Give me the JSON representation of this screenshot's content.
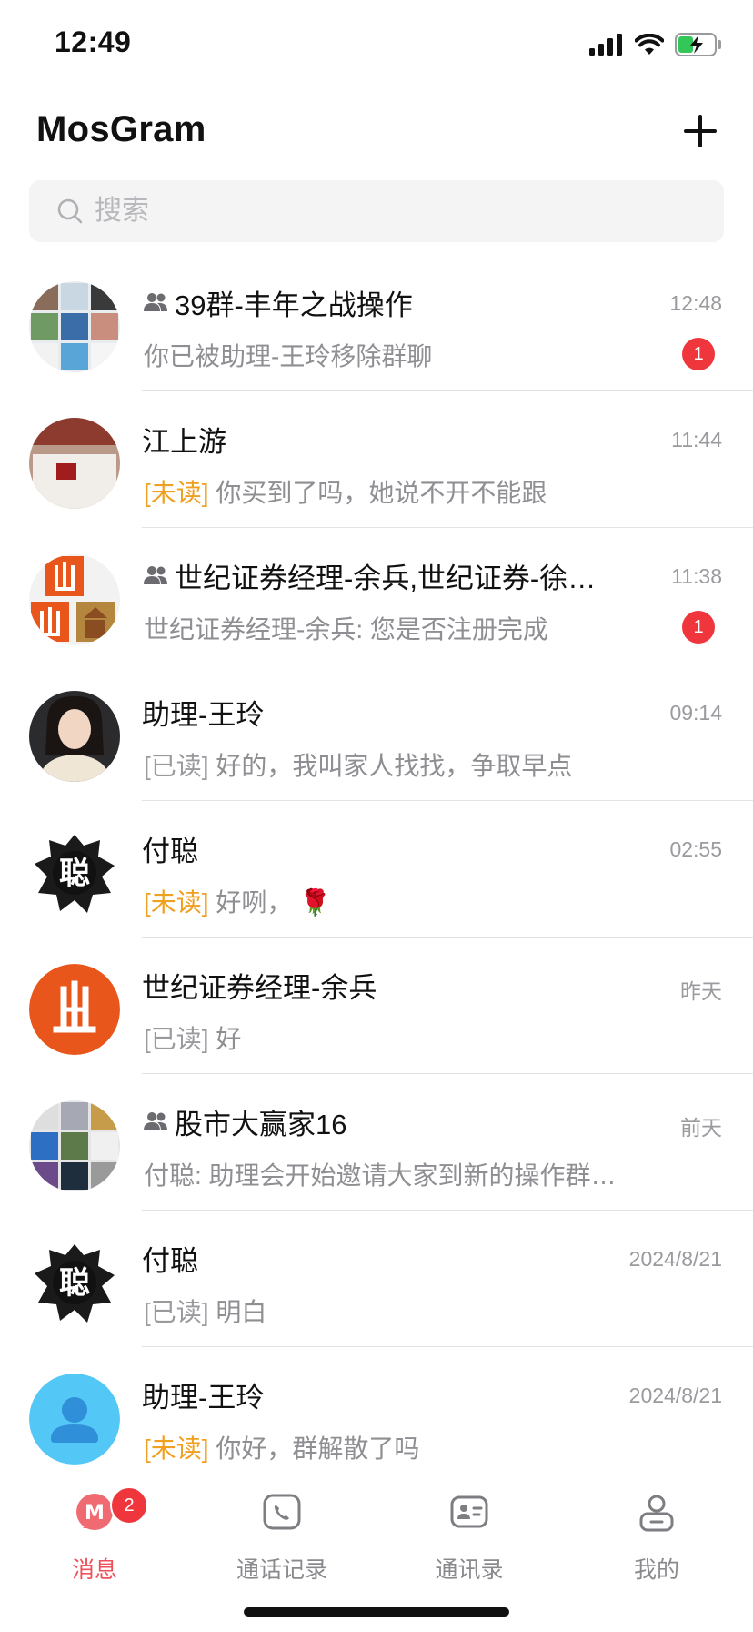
{
  "status_bar": {
    "time": "12:49",
    "icons": [
      "cellular-signal-icon",
      "wifi-icon",
      "battery-charging-icon"
    ]
  },
  "header": {
    "title": "MosGram",
    "add_icon": "plus-icon"
  },
  "search": {
    "placeholder": "搜索",
    "icon": "search-icon"
  },
  "chats": [
    {
      "title": "39群-丰年之战操作",
      "group": true,
      "time": "12:48",
      "tag": "",
      "preview": "你已被助理-王玲移除群聊",
      "badge": "1",
      "avatar": "group-collage"
    },
    {
      "title": "江上游",
      "group": false,
      "time": "11:44",
      "tag": "[未读]",
      "tag_type": "unread",
      "preview": "你买到了吗，她说不开不能跟",
      "badge": "",
      "avatar": "photo"
    },
    {
      "title": "世纪证券经理-余兵,世纪证券-徐…",
      "group": true,
      "time": "11:38",
      "tag": "",
      "preview": "世纪证券经理-余兵: 您是否注册完成",
      "badge": "1",
      "avatar": "group-logo"
    },
    {
      "title": "助理-王玲",
      "group": false,
      "time": "09:14",
      "tag": "[已读]",
      "tag_type": "read",
      "preview": "好的，我叫家人找找，争取早点",
      "badge": "",
      "avatar": "portrait"
    },
    {
      "title": "付聪",
      "group": false,
      "time": "02:55",
      "tag": "[未读]",
      "tag_type": "unread",
      "preview": "好咧， 🌹",
      "badge": "",
      "avatar": "ink"
    },
    {
      "title": "世纪证券经理-余兵",
      "group": false,
      "time": "昨天",
      "tag": "[已读]",
      "tag_type": "read",
      "preview": "好",
      "badge": "",
      "avatar": "logo"
    },
    {
      "title": "股市大赢家16",
      "group": true,
      "time": "前天",
      "tag": "",
      "preview": "付聪: 助理会开始邀请大家到新的操作群…",
      "badge": "",
      "avatar": "group-collage2"
    },
    {
      "title": "付聪",
      "group": false,
      "time": "2024/8/21",
      "tag": "[已读]",
      "tag_type": "read",
      "preview": "明白",
      "badge": "",
      "avatar": "ink"
    },
    {
      "title": "助理-王玲",
      "group": false,
      "time": "2024/8/21",
      "tag": "[未读]",
      "tag_type": "unread",
      "preview": "你好，群解散了吗",
      "badge": "",
      "avatar": "default"
    }
  ],
  "tab_bar": {
    "tabs": [
      {
        "label": "消息",
        "icon": "messages-icon",
        "active": true,
        "badge": "2"
      },
      {
        "label": "通话记录",
        "icon": "call-log-icon",
        "active": false
      },
      {
        "label": "通讯录",
        "icon": "contacts-icon",
        "active": false
      },
      {
        "label": "我的",
        "icon": "profile-icon",
        "active": false
      }
    ]
  },
  "colors": {
    "accent": "#f0505a",
    "badge": "#f0363d",
    "unread_tag": "#f0a020",
    "logo_orange": "#e8561b"
  }
}
